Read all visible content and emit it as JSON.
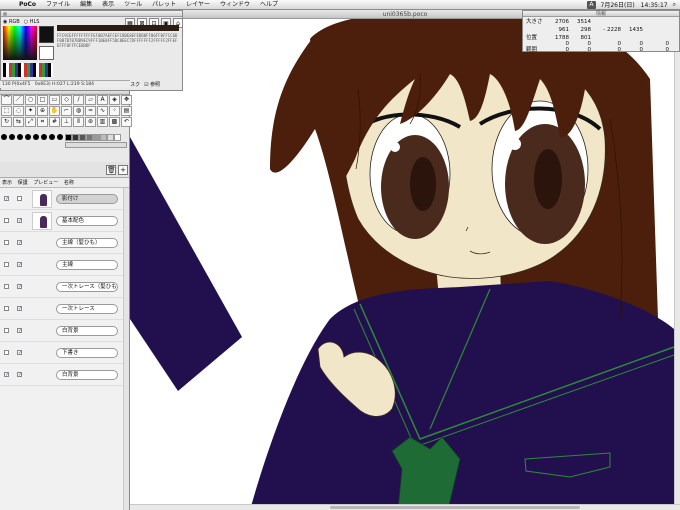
{
  "menubar": {
    "apple": "",
    "app": "PoCo",
    "items": [
      "ファイル",
      "編集",
      "表示",
      "ツール",
      "パレット",
      "レイヤー",
      "ウィンドウ",
      "ヘルプ"
    ],
    "input_badge": "A",
    "clock": "7月26日(日)　14:35:17"
  },
  "document": {
    "title": "uni0365b.poco"
  },
  "color_panel": {
    "mode_rgb": "RGB",
    "mode_hls": "HLS",
    "hex_dump": "FFC9CEFFFFFFFFFEF0B7AEFCEFC8BE8EFEDB8FF06FF0FFCC6DF0B7B7B7BB9EC9FFF1BE0FF5DC8EEC7DFFFFFFF2FFFFF2FFEFEFFF0FFFCEBDDF",
    "check1": "マスク",
    "check2": "参照"
  },
  "status_line": "130 P(0x4F5　0x6E3) H:027 L:219 S:184 ",
  "layers": {
    "headers": [
      "表示",
      "保護",
      "プレビュー",
      "名称"
    ],
    "rows": [
      {
        "name": "影付け",
        "visible": "✓",
        "locked": "",
        "thumb": true,
        "selected": true
      },
      {
        "name": "基本配色",
        "visible": "",
        "locked": "✓",
        "thumb": true,
        "selected": false
      },
      {
        "name": "主線（髪ひも）",
        "visible": "",
        "locked": "✓",
        "thumb": false,
        "selected": false
      },
      {
        "name": "主線",
        "visible": "",
        "locked": "✓",
        "thumb": false,
        "selected": false
      },
      {
        "name": "一次トレース（髪ひも",
        "visible": "",
        "locked": "✓",
        "thumb": false,
        "selected": false
      },
      {
        "name": "一次トレース",
        "visible": "",
        "locked": "✓",
        "thumb": false,
        "selected": false
      },
      {
        "name": "白背景",
        "visible": "",
        "locked": "✓",
        "thumb": false,
        "selected": false
      },
      {
        "name": "下書き",
        "visible": "",
        "locked": "✓",
        "thumb": false,
        "selected": false
      },
      {
        "name": "白背景",
        "visible": "✓",
        "locked": "✓",
        "thumb": false,
        "selected": false
      }
    ]
  },
  "info": {
    "title": "情報",
    "size_label": "大きさ",
    "size_w": "2706",
    "size_h": "3514",
    "view_a": "961",
    "view_b": "298",
    "view_c": "- 2228",
    "view_d": "1435",
    "pos_label": "位置",
    "pos_x": "1788",
    "pos_y": "801",
    "range_label": "範囲",
    "r1": "0",
    "r2": "0",
    "r3": "0",
    "r4": "0",
    "r5": "0",
    "r6": "0",
    "r7": "0",
    "r8": "0",
    "r9": "0",
    "r10": "0"
  },
  "colors": {
    "hair": "#4b1f0c",
    "skin": "#f2e6c8",
    "uniform": "#22104e",
    "tie": "#1e6b35",
    "eye": "#4a2a1c"
  }
}
